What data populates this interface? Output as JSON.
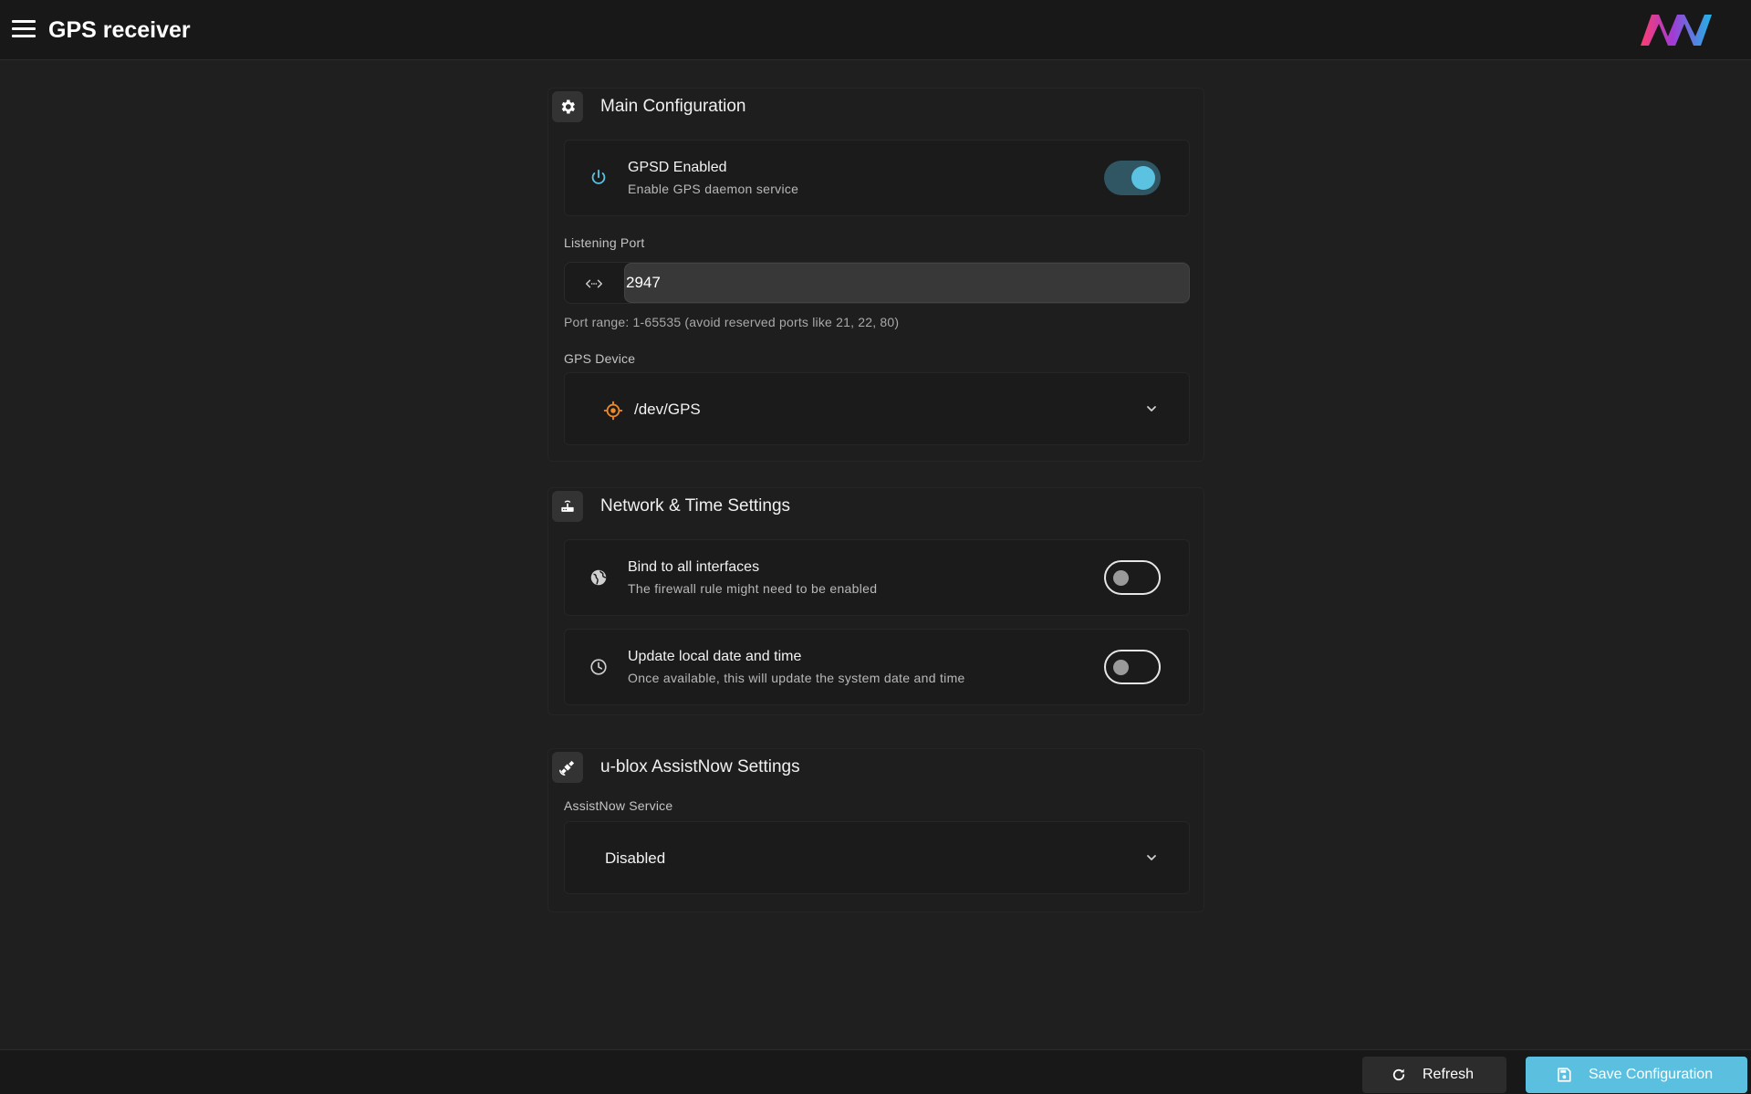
{
  "header": {
    "title": "GPS receiver",
    "menu_icon": "menu-icon",
    "logo_icon": "brand-logo"
  },
  "main_configuration": {
    "title": "Main Configuration",
    "icon": "gear-icon",
    "gpsd": {
      "title": "GPSD Enabled",
      "subtitle": "Enable GPS daemon service",
      "icon": "power-icon",
      "enabled": true
    },
    "port": {
      "label": "Listening Port",
      "value": "2947",
      "icon": "code-arrows-icon",
      "hint": "Port range: 1-65535 (avoid reserved ports like 21, 22, 80)"
    },
    "device": {
      "label": "GPS Device",
      "value": "/dev/GPS",
      "icon": "gps-target-icon"
    }
  },
  "network_time": {
    "title": "Network & Time Settings",
    "icon": "router-icon",
    "bind_all": {
      "title": "Bind to all interfaces",
      "subtitle": "The firewall rule might need to be enabled",
      "icon": "globe-icon",
      "enabled": false
    },
    "update_time": {
      "title": "Update local date and time",
      "subtitle": "Once available, this will update the system date and time",
      "icon": "clock-icon",
      "enabled": false
    }
  },
  "assistnow": {
    "title": "u-blox AssistNow Settings",
    "icon": "satellite-icon",
    "service": {
      "label": "AssistNow Service",
      "value": "Disabled"
    }
  },
  "footer": {
    "refresh_label": "Refresh",
    "save_label": "Save Configuration"
  },
  "colors": {
    "accent": "#5bc2e2",
    "background": "#1f1f1f",
    "gps_icon": "#f08a24"
  }
}
